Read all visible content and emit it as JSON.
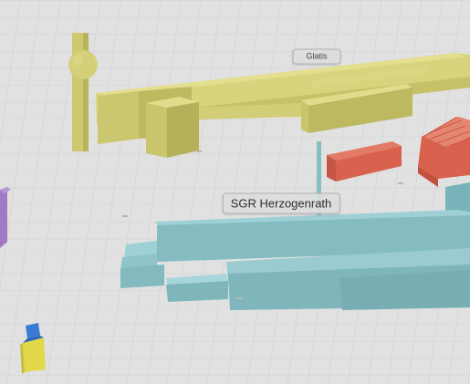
{
  "labels": {
    "glatis": "Glatis",
    "sgr": "SGR Herzogenrath"
  },
  "colors": {
    "ground": "#e1e1e1",
    "grid_line": "#cfcfcf",
    "yellow_building": "#d6d27a",
    "cyan_building": "#7fb9bf",
    "red_building": "#d9624e",
    "purple_building": "#a07ac2",
    "car_blue": "#3a7bd5",
    "car_yellow": "#e3d84a"
  }
}
